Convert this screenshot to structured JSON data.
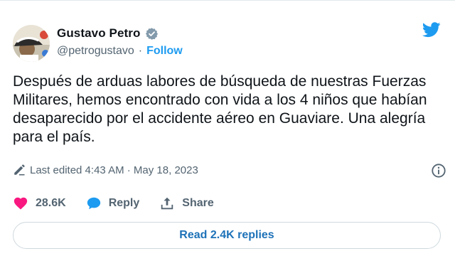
{
  "author": {
    "name": "Gustavo Petro",
    "handle": "@petrogustavo",
    "separator": "·",
    "follow_label": "Follow"
  },
  "tweet": {
    "text": "Después de arduas labores de búsqueda de nuestras Fuerzas Militares, hemos encontrado con vida a los 4 niños que habían desaparecido por el accidente aéreo en Guaviare. Una alegría para el país."
  },
  "meta": {
    "edited_label": "Last edited 4:43 AM · May 18, 2023"
  },
  "actions": {
    "likes": "28.6K",
    "reply_label": "Reply",
    "share_label": "Share"
  },
  "replies_button": "Read 2.4K replies",
  "colors": {
    "accent": "#1d9bf0",
    "like": "#f91880",
    "text": "#0f1419",
    "muted": "#536471"
  },
  "icons": [
    "avatar",
    "verified-badge-icon",
    "twitter-bird-icon",
    "pencil-icon",
    "info-icon",
    "heart-icon",
    "reply-bubble-icon",
    "share-icon"
  ]
}
